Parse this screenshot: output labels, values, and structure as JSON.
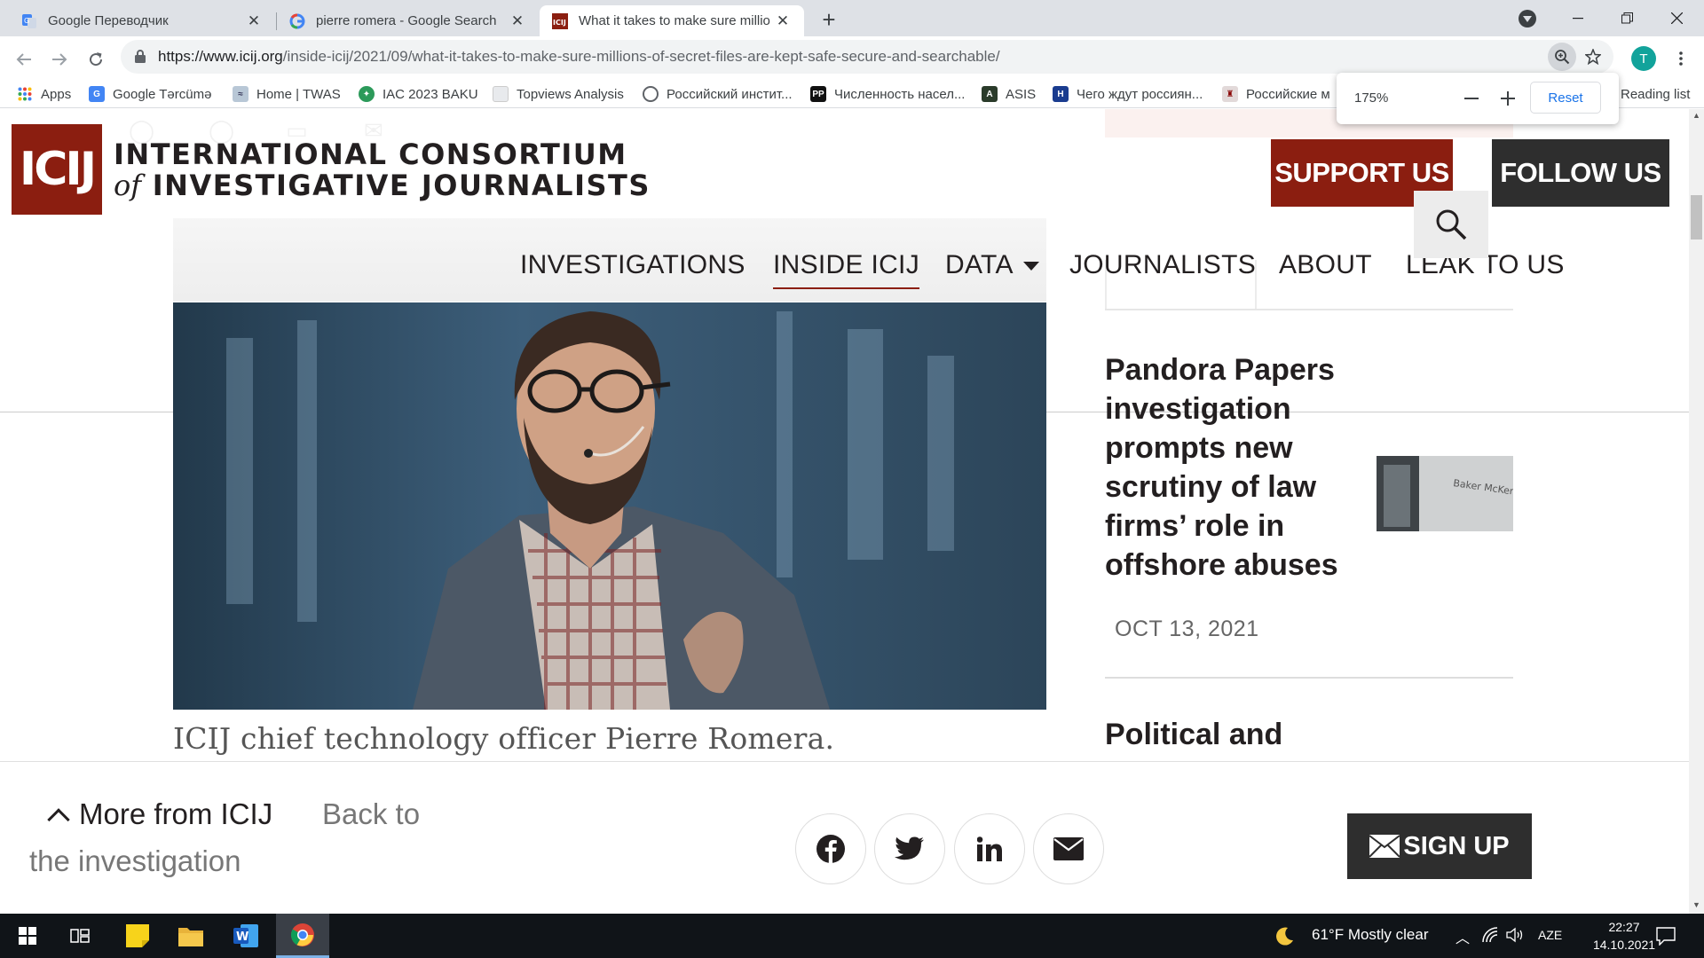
{
  "browser": {
    "tabs": [
      {
        "title": "Google Переводчик",
        "icon": "google-translate-icon"
      },
      {
        "title": "pierre romera - Google Search",
        "icon": "google-icon"
      },
      {
        "title": "What it takes to make sure millio",
        "icon": "icij-icon",
        "active": true
      }
    ],
    "url_domain": "https://www.icij.org",
    "url_path": "/inside-icij/2021/09/what-it-takes-to-make-sure-millions-of-secret-files-are-kept-safe-secure-and-searchable/",
    "profile_initial": "T",
    "bookmarks": [
      {
        "label": "Apps",
        "icon": "apps-grid-icon"
      },
      {
        "label": "Google Tərcümə",
        "icon": "google-translate-icon"
      },
      {
        "label": "Home | TWAS",
        "icon": "twas-icon"
      },
      {
        "label": "IAC 2023 BAKU",
        "icon": "iac-icon"
      },
      {
        "label": "Topviews Analysis",
        "icon": "page-icon"
      },
      {
        "label": "Российский инстит...",
        "icon": "globe-icon"
      },
      {
        "label": "Численность насел...",
        "icon": "pp-icon"
      },
      {
        "label": "ASIS",
        "icon": "asis-icon"
      },
      {
        "label": "Чего ждут россиян...",
        "icon": "h-icon"
      },
      {
        "label": "Российские м",
        "icon": "crest-icon"
      }
    ],
    "reading_list": "Reading list",
    "zoom": {
      "level": "175%",
      "reset": "Reset"
    }
  },
  "site": {
    "logo_mark": "ICIJ",
    "logo_line1": "INTERNATIONAL CONSORTIUM",
    "logo_line2_of": "of",
    "logo_line2": "INVESTIGATIVE JOURNALISTS",
    "support": "SUPPORT US",
    "follow": "FOLLOW US",
    "nav": [
      "INVESTIGATIONS",
      "INSIDE ICIJ",
      "DATA",
      "JOURNALISTS",
      "ABOUT",
      "LEAK TO US"
    ],
    "active_nav": "INSIDE ICIJ",
    "caption": "ICIJ chief technology officer Pierre Romera.",
    "side_title": "Pandora Papers investigation prompts new scrutiny of law firms’ role in offshore abuses",
    "thumb_text": "Baker McKenzie",
    "side_date": "OCT 13, 2021",
    "side_title2": "Political and",
    "more_from": "More from ICIJ",
    "back_to_1": "Back to",
    "back_to_2": "the investigation",
    "signup": "SIGN UP"
  },
  "taskbar": {
    "weather": "61°F  Mostly clear",
    "lang": "AZE",
    "time": "22:27",
    "date": "14.10.2021"
  },
  "colors": {
    "brand": "#8b1e10",
    "dark": "#2e2e2e"
  }
}
